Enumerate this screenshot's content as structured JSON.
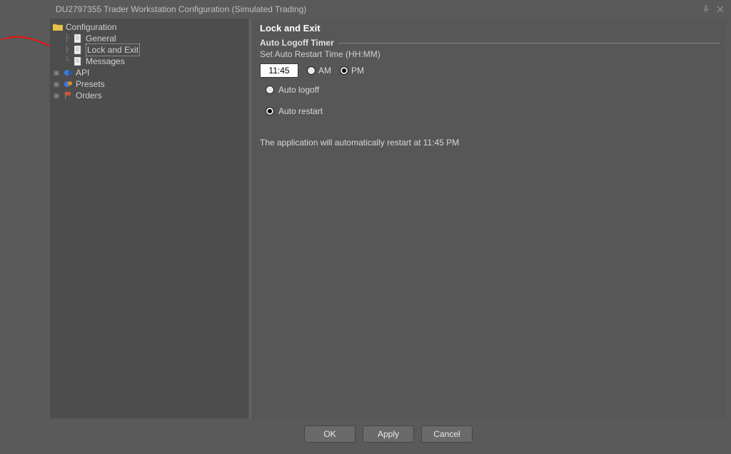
{
  "window": {
    "title": "DU2797355 Trader Workstation Configuration (Simulated Trading)"
  },
  "sidebar": {
    "root_label": "Configuration",
    "items": [
      {
        "label": "General",
        "icon": "page-icon"
      },
      {
        "label": "Lock and Exit",
        "icon": "page-icon",
        "selected": true
      },
      {
        "label": "Messages",
        "icon": "page-icon"
      },
      {
        "label": "API",
        "icon": "gear-blue-icon",
        "expandable": true
      },
      {
        "label": "Presets",
        "icon": "gear-orange-icon",
        "expandable": true
      },
      {
        "label": "Orders",
        "icon": "flag-icon",
        "expandable": true
      }
    ]
  },
  "main": {
    "page_title": "Lock and Exit",
    "section_title": "Auto Logoff Timer",
    "subhead": "Set Auto Restart Time (HH:MM)",
    "time_value": "11:45",
    "ampm": {
      "am_label": "AM",
      "pm_label": "PM",
      "selected": "PM"
    },
    "mode": {
      "logoff_label": "Auto logoff",
      "restart_label": "Auto restart",
      "selected": "restart"
    },
    "description": "The application will automatically restart at 11:45 PM"
  },
  "buttons": {
    "ok": "OK",
    "apply": "Apply",
    "cancel": "Cancel"
  }
}
